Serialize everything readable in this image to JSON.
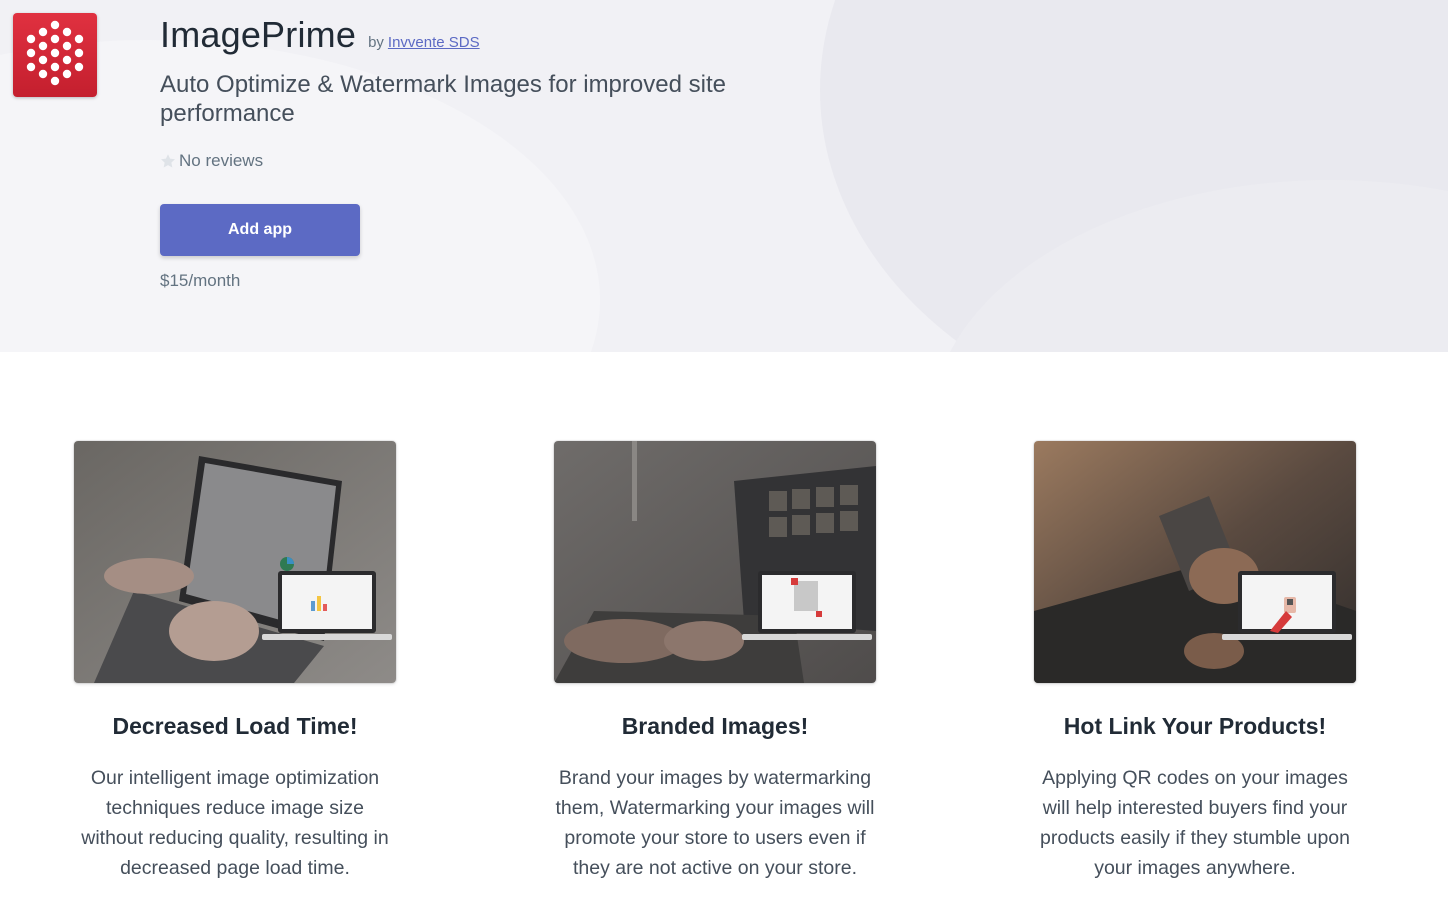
{
  "header": {
    "app_name": "ImagePrime",
    "by_label": "by",
    "developer": "Invvente SDS",
    "tagline": "Auto Optimize & Watermark Images for improved site performance",
    "rating_icon": "star-icon",
    "reviews_text": "No reviews",
    "add_button_label": "Add app",
    "price": "$15/month",
    "logo_icon": "hexagon-dots-logo",
    "logo_color": "#d92535",
    "accent_color": "#5c6ac4"
  },
  "features": [
    {
      "title": "Decreased Load Time!",
      "description": "Our intelligent image optimization techniques reduce image size without reducing quality, resulting in decreased page load time.",
      "image_icon": "laptop-analytics-image"
    },
    {
      "title": "Branded Images!",
      "description": "Brand your images by watermarking them, Watermarking your images will promote your store to users even if they are not active on your store.",
      "image_icon": "laptop-watermark-image"
    },
    {
      "title": "Hot Link Your Products!",
      "description": "Applying QR codes on your images will help interested buyers find your products easily if they stumble upon your images anywhere.",
      "image_icon": "laptop-qr-phone-image"
    }
  ]
}
